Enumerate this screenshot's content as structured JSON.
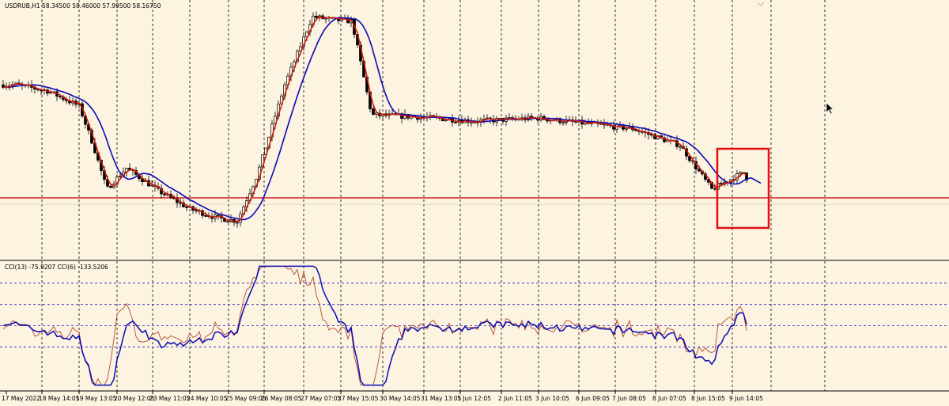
{
  "header": {
    "price_title": "USDRUB,H1  58.34500 58.46000 57.99500 58.16750",
    "indicator_title": "CCI(13) -75.9207  CCI(6) -133.5206"
  },
  "colors": {
    "background": "#fcf3e1",
    "frame": "#000000",
    "grid": "#000000",
    "candle_up_fill": "#fcf3e1",
    "candle_down_fill": "#000000",
    "ma_fast": "#d01a0c",
    "ma_slow": "#0a0ab5",
    "cci_fast": "#b24a2c",
    "cci_slow": "#0a0ab5",
    "level_line": "#d42020",
    "highlight_box": "#e01010",
    "cci_level_lines": "#2020c0"
  },
  "icons": {
    "cursor": "mouse-pointer-icon"
  },
  "chart_data": [
    {
      "type": "candlestick",
      "symbol": "USDRUB",
      "timeframe": "H1",
      "ylim": [
        55.4,
        72.6
      ],
      "grid": "vertical-dotted",
      "x_ticks": [
        "17 May 2022",
        "18 May 14:05",
        "19 May 13:05",
        "20 May 12:05",
        "23 May 11:05",
        "24 May 10:05",
        "25 May 09:05",
        "26 May 08:05",
        "27 May 07:05",
        "27 May 15:05",
        "30 May 14:05",
        "31 May 13:05",
        "1 Jun 12:05",
        "2 Jun 11:05",
        "3 Jun 10:05",
        "6 Jun 09:05",
        "7 Jun 08:05",
        "8 Jun 07:05",
        "8 Jun 15:05",
        "9 Jun 14:05"
      ],
      "horizontal_level": 60.6,
      "highlight_region": {
        "from": "8 Jun 15:05",
        "to": "9 Jun 14:05"
      },
      "close_points": [
        {
          "x": "17 May 2022",
          "y": 67.0
        },
        {
          "x": "18 May 14:05",
          "y": 65.8
        },
        {
          "x": "19 May 13:05",
          "y": 65.3
        },
        {
          "x": "19 May (late)",
          "y": 60.1
        },
        {
          "x": "20 May 12:05",
          "y": 62.3
        },
        {
          "x": "23 May 11:05",
          "y": 60.0
        },
        {
          "x": "24 May 10:05",
          "y": 58.8
        },
        {
          "x": "25 May 09:05",
          "y": 58.2
        },
        {
          "x": "25 May (late)",
          "y": 60.5
        },
        {
          "x": "26 May 08:05",
          "y": 67.1
        },
        {
          "x": "27 May 07:05",
          "y": 71.5
        },
        {
          "x": "27 May (mid)",
          "y": 71.3
        },
        {
          "x": "27 May 15:05",
          "y": 64.9
        },
        {
          "x": "30 May 14:05",
          "y": 64.9
        },
        {
          "x": "31 May 13:05",
          "y": 64.7
        },
        {
          "x": "1 Jun 12:05",
          "y": 64.6
        },
        {
          "x": "2 Jun 11:05",
          "y": 64.9
        },
        {
          "x": "3 Jun 10:05",
          "y": 64.5
        },
        {
          "x": "6 Jun 09:05",
          "y": 64.1
        },
        {
          "x": "7 Jun 08:05",
          "y": 64.0
        },
        {
          "x": "8 Jun 07:05",
          "y": 63.0
        },
        {
          "x": "8 Jun 15:05",
          "y": 60.1
        },
        {
          "x": "9 Jun 14:05",
          "y": 61.2
        },
        {
          "x": "9 Jun (last)",
          "y": 60.5
        }
      ]
    },
    {
      "type": "line",
      "name": "CCI",
      "ylim": [
        -300,
        300
      ],
      "levels": [
        200,
        100,
        0,
        -100
      ],
      "x_ticks_shared": true
    }
  ]
}
